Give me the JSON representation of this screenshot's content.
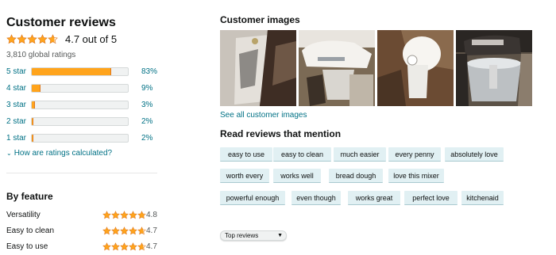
{
  "summary": {
    "title": "Customer reviews",
    "rating": 4.7,
    "avg_label": "4.7 out of 5",
    "global_ratings": "3,810 global ratings"
  },
  "histogram": [
    {
      "label": "5 star",
      "pct_text": "83%",
      "pct": 83
    },
    {
      "label": "4 star",
      "pct_text": "9%",
      "pct": 9
    },
    {
      "label": "3 star",
      "pct_text": "3%",
      "pct": 3
    },
    {
      "label": "2 star",
      "pct_text": "2%",
      "pct": 2
    },
    {
      "label": "1 star",
      "pct_text": "2%",
      "pct": 2
    }
  ],
  "how_link": "How are ratings calculated?",
  "features": {
    "title": "By feature",
    "items": [
      {
        "name": "Versatility",
        "rating": 4.8,
        "rating_text": "4.8"
      },
      {
        "name": "Easy to clean",
        "rating": 4.7,
        "rating_text": "4.7"
      },
      {
        "name": "Easy to use",
        "rating": 4.7,
        "rating_text": "4.7"
      }
    ]
  },
  "customer_images": {
    "title": "Customer images",
    "see_all": "See all customer images"
  },
  "mentions": {
    "title": "Read reviews that mention",
    "chips": [
      "easy to use",
      "easy to clean",
      "much easier",
      "every penny",
      "absolutely love",
      "worth every",
      "works well",
      "bread dough",
      "love this mixer",
      "powerful enough",
      "even though",
      "works great",
      "perfect love",
      "kitchenaid"
    ]
  },
  "sort": {
    "selected": "Top reviews"
  },
  "colors": {
    "star": "#ffa41c",
    "link": "#007185",
    "chip": "#e1f0f3",
    "bar_fill": "#ffa41c"
  }
}
